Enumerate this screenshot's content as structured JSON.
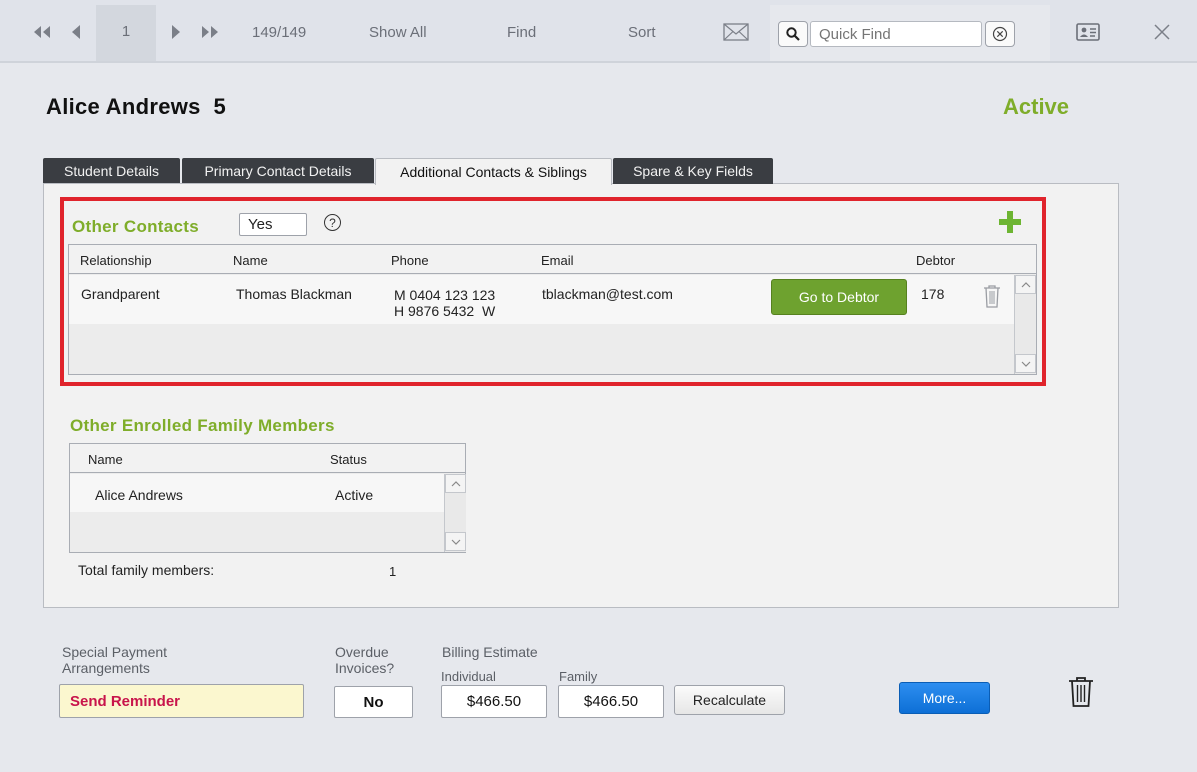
{
  "toolbar": {
    "record_number": "1",
    "record_count": "149/149",
    "show_all": "Show All",
    "find": "Find",
    "sort": "Sort",
    "quick_find_placeholder": "Quick Find"
  },
  "header": {
    "student_name": "Alice Andrews  5",
    "status": "Active"
  },
  "tabs": [
    {
      "label": "Student Details"
    },
    {
      "label": "Primary Contact Details"
    },
    {
      "label": "Additional Contacts & Siblings"
    },
    {
      "label": "Spare & Key Fields"
    }
  ],
  "other_contacts": {
    "label": "Other Contacts",
    "value": "Yes",
    "help": "?",
    "columns": [
      "Relationship",
      "Name",
      "Phone",
      "Email",
      "Debtor"
    ],
    "rows": [
      {
        "relationship": "Grandparent",
        "name": "Thomas Blackman",
        "phone_mobile": "M 0404 123 123",
        "phone_home": "H 9876 5432  W",
        "email": "tblackman@test.com",
        "debtor_button": "Go to Debtor",
        "debtor": "178"
      }
    ]
  },
  "family": {
    "label": "Other Enrolled Family Members",
    "columns": [
      "Name",
      "Status"
    ],
    "rows": [
      {
        "name": "Alice Andrews",
        "status": "Active"
      }
    ],
    "total_label": "Total family members:",
    "total_value": "1"
  },
  "billing": {
    "special_label_1": "Special Payment",
    "special_label_2": "Arrangements",
    "special_value": "Send Reminder",
    "overdue_label_1": "Overdue",
    "overdue_label_2": "Invoices?",
    "overdue_value": "No",
    "estimate_label": "Billing Estimate",
    "individual_label": "Individual",
    "individual_value": "$466.50",
    "family_label": "Family",
    "family_value": "$466.50",
    "recalculate": "Recalculate",
    "more": "More..."
  },
  "colors": {
    "accent_green": "#7fad2a",
    "highlight_red": "#e0242c",
    "button_blue": "#0d6fd6",
    "reminder_text": "#c8144b",
    "reminder_bg": "#fbf7cf"
  }
}
